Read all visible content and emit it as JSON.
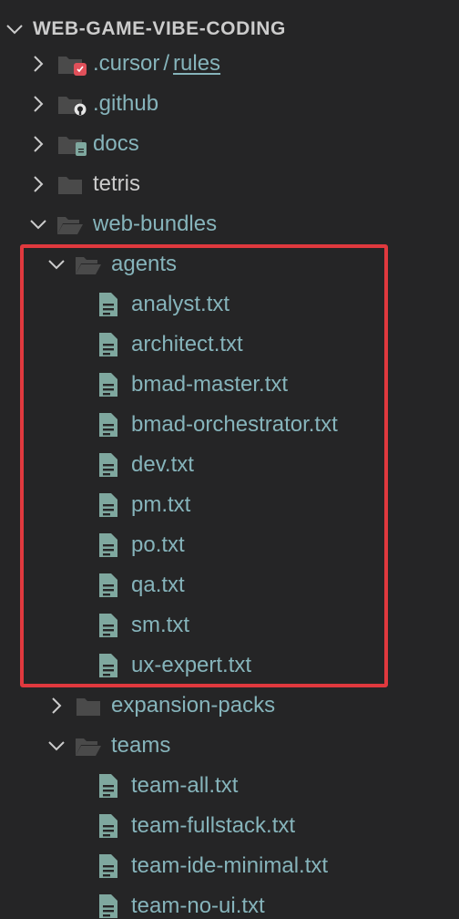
{
  "explorer": {
    "root_label": "WEB-GAME-VIBE-CODING",
    "items": [
      {
        "label": ".cursor",
        "sublabel": "rules",
        "separator": "/"
      },
      {
        "label": ".github"
      },
      {
        "label": "docs"
      },
      {
        "label": "tetris"
      },
      {
        "label": "web-bundles"
      },
      {
        "label": "agents"
      },
      {
        "label": "analyst.txt"
      },
      {
        "label": "architect.txt"
      },
      {
        "label": "bmad-master.txt"
      },
      {
        "label": "bmad-orchestrator.txt"
      },
      {
        "label": "dev.txt"
      },
      {
        "label": "pm.txt"
      },
      {
        "label": "po.txt"
      },
      {
        "label": "qa.txt"
      },
      {
        "label": "sm.txt"
      },
      {
        "label": "ux-expert.txt"
      },
      {
        "label": "expansion-packs"
      },
      {
        "label": "teams"
      },
      {
        "label": "team-all.txt"
      },
      {
        "label": "team-fullstack.txt"
      },
      {
        "label": "team-ide-minimal.txt"
      },
      {
        "label": "team-no-ui.txt"
      }
    ]
  },
  "colors": {
    "background": "#252526",
    "folder_icon": "#4a4a4a",
    "file_icon": "#7fa89f",
    "label_teal": "#86b4bb",
    "label_grey": "#cccccc",
    "highlight_border": "#e0393e"
  }
}
